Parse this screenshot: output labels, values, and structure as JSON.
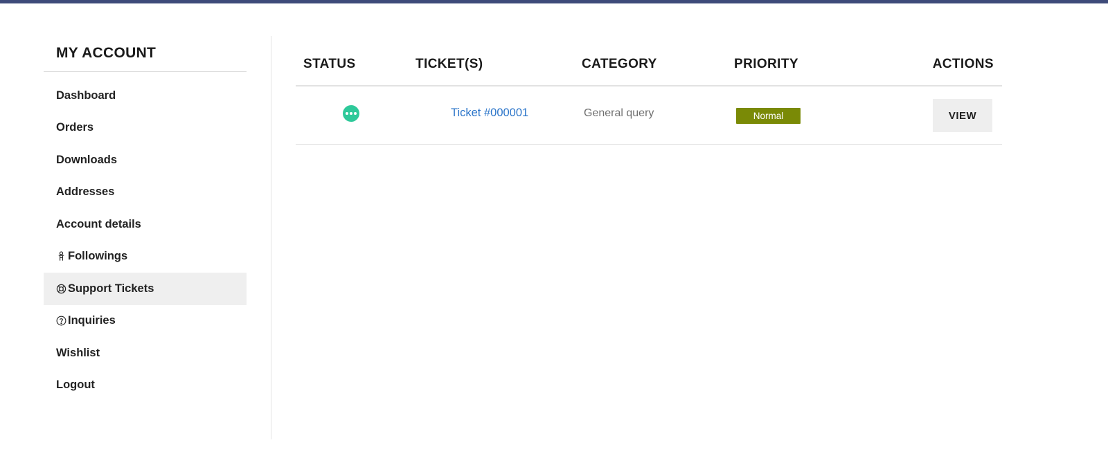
{
  "colors": {
    "top_bar": "#3e4b7a",
    "status_open": "#2ec99a",
    "link": "#2a74c9",
    "priority_normal": "#7a8a06",
    "active_nav_bg": "#efefef"
  },
  "sidebar": {
    "title": "MY ACCOUNT",
    "items": [
      {
        "label": "Dashboard",
        "icon": ""
      },
      {
        "label": "Orders",
        "icon": ""
      },
      {
        "label": "Downloads",
        "icon": ""
      },
      {
        "label": "Addresses",
        "icon": ""
      },
      {
        "label": "Account details",
        "icon": ""
      },
      {
        "label": "Followings",
        "icon": "person-icon"
      },
      {
        "label": "Support Tickets",
        "icon": "lifebuoy-icon",
        "active": true
      },
      {
        "label": "Inquiries",
        "icon": "question-circle-icon"
      },
      {
        "label": "Wishlist",
        "icon": ""
      },
      {
        "label": "Logout",
        "icon": ""
      }
    ]
  },
  "table": {
    "headers": {
      "status": "STATUS",
      "tickets": "TICKET(S)",
      "category": "CATEGORY",
      "priority": "PRIORITY",
      "actions": "ACTIONS"
    },
    "rows": [
      {
        "status_icon": "ellipsis-circle-icon",
        "ticket": "Ticket #000001",
        "category": "General query",
        "priority": "Normal",
        "action": "VIEW"
      }
    ]
  }
}
